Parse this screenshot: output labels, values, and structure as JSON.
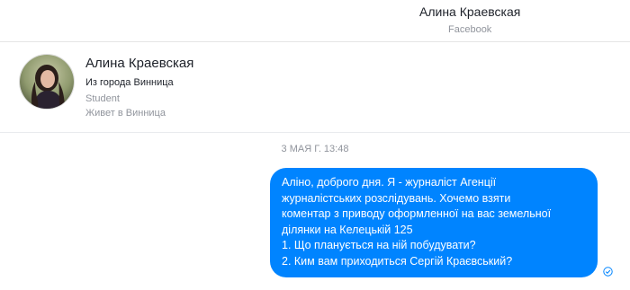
{
  "header": {
    "name": "Алина Краевская",
    "subtitle": "Facebook"
  },
  "profile": {
    "name": "Алина Краевская",
    "city": "Из города Винница",
    "work": "Student",
    "lives": "Живет в Винница"
  },
  "conversation": {
    "timestamp": "3 МАЯ Г. 13:48",
    "message": {
      "lines": [
        "Аліно, доброго дня. Я - журналіст Агенції",
        "журналістських розслідувань. Хочемо взяти",
        "коментар з приводу оформленної на вас земельної",
        "ділянки на Келецькій 125",
        "1. Що планується на ній побудувати?",
        "2. Ким вам приходиться Сергій Краєвський?"
      ],
      "bubble_color": "#0084ff",
      "status_icon": "seen-check-icon"
    }
  }
}
